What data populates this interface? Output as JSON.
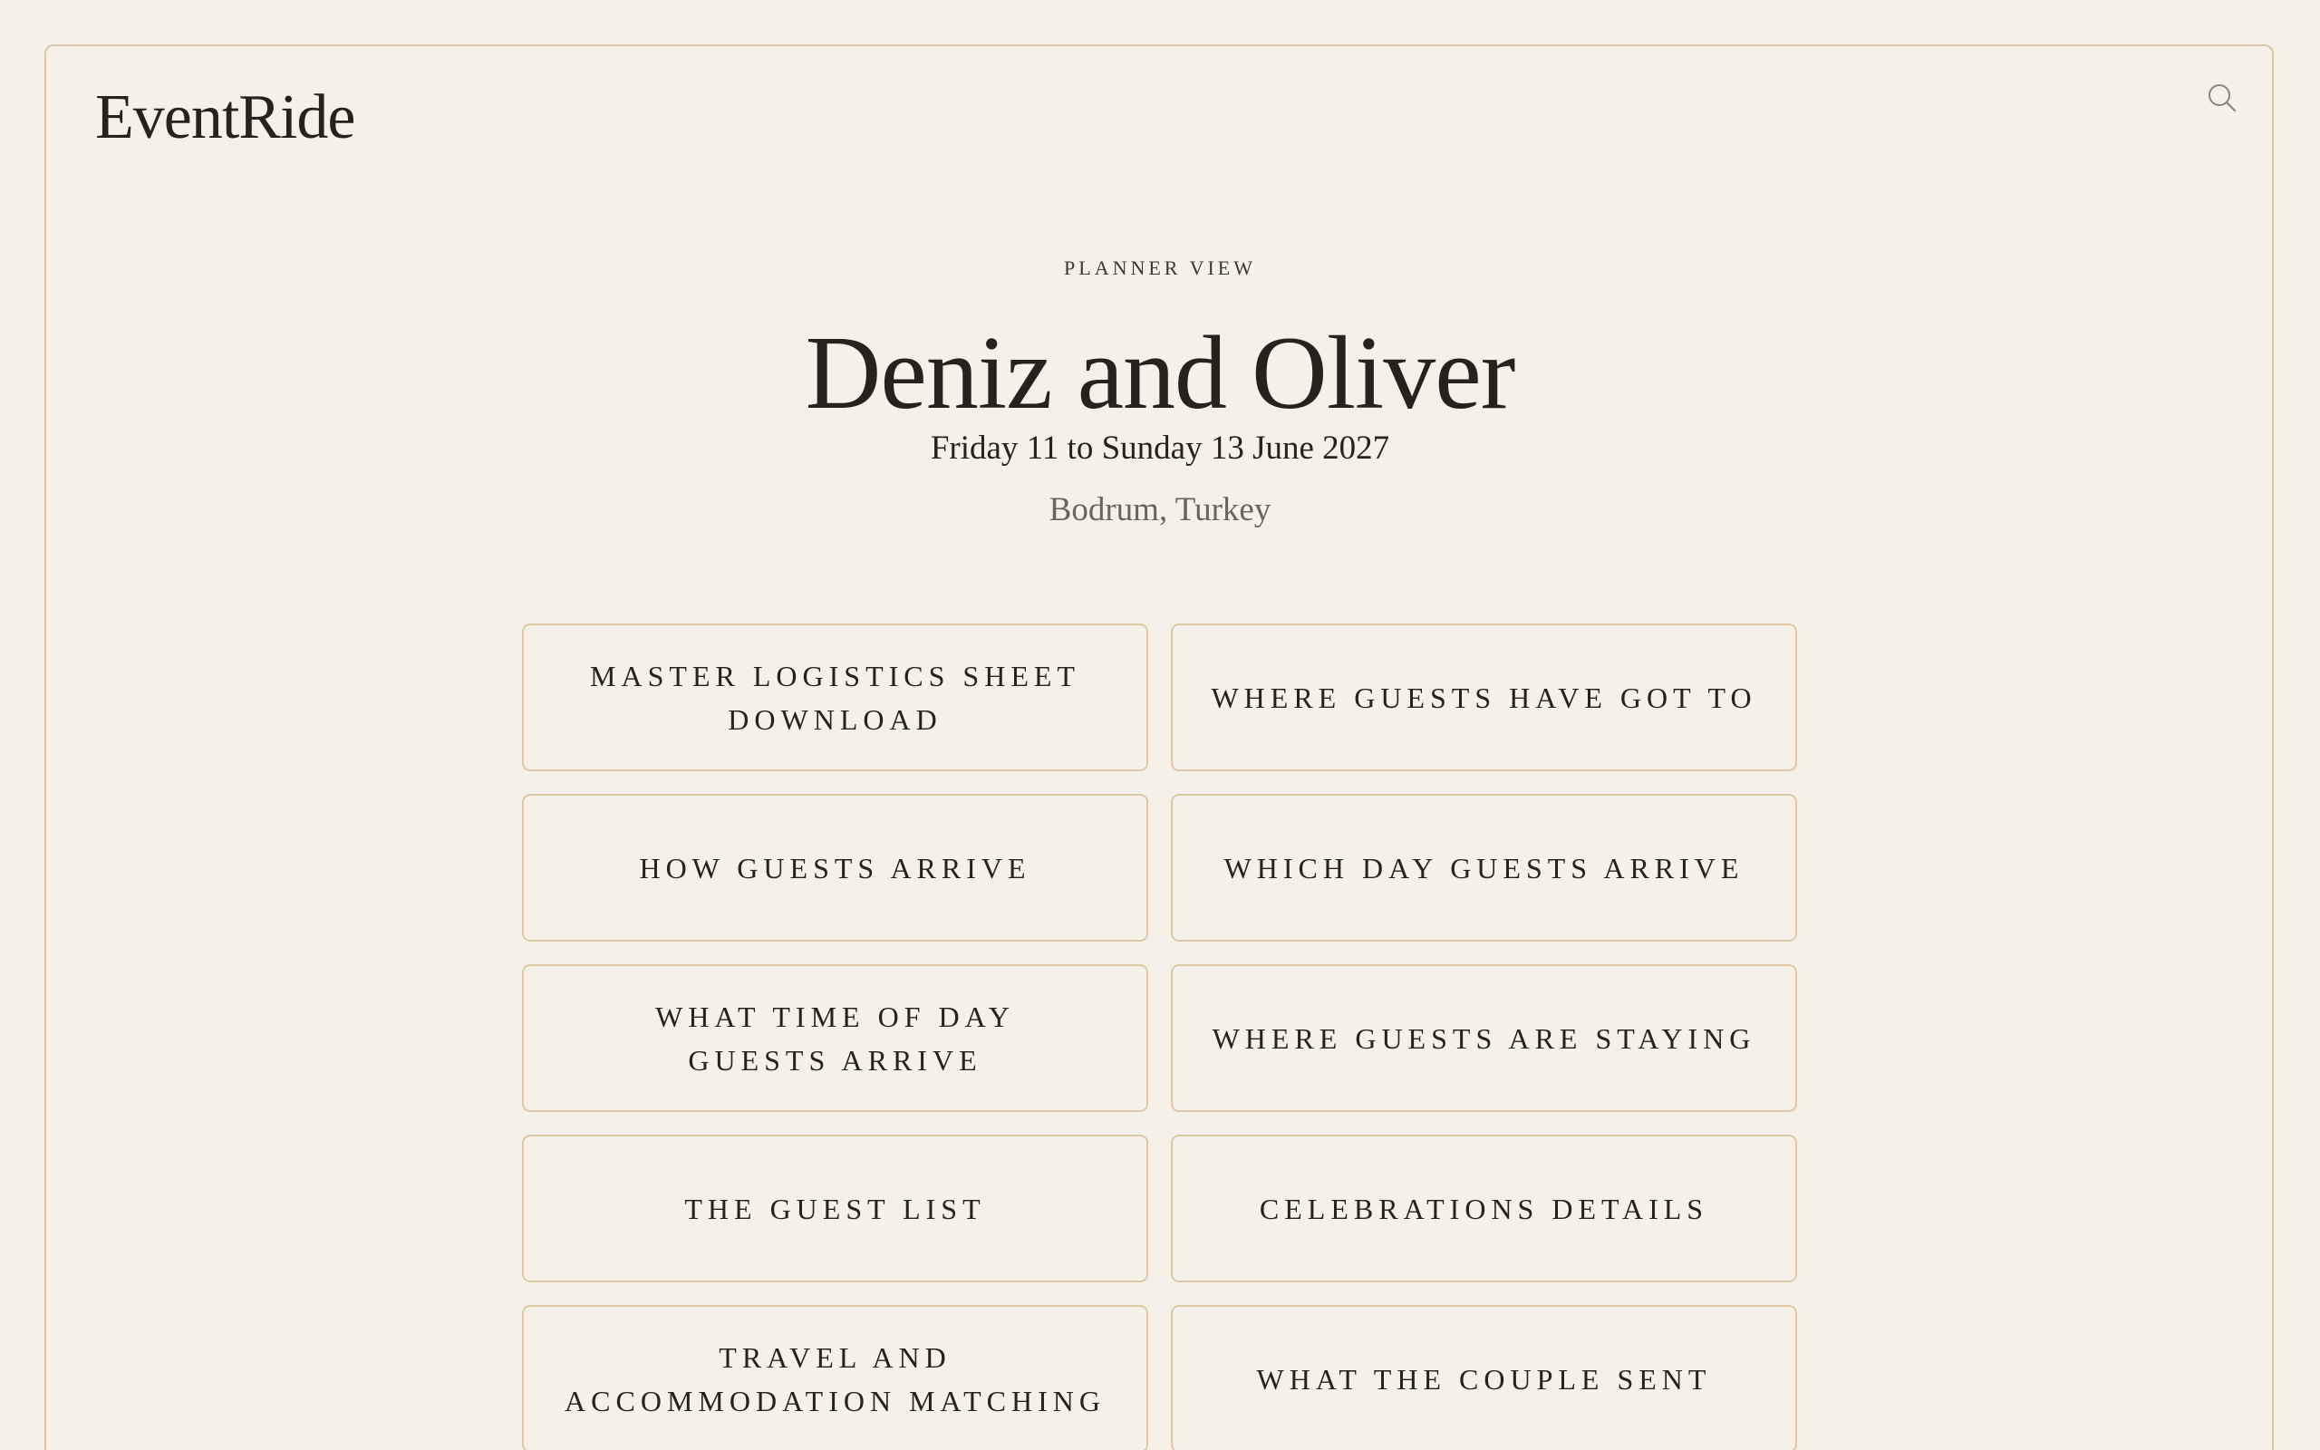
{
  "header": {
    "brand": "EventRide",
    "search_icon": "search-icon"
  },
  "event": {
    "eyebrow": "PLANNER VIEW",
    "title": "Deniz and Oliver",
    "dates": "Friday 11 to Sunday 13 June 2027",
    "location": "Bodrum, Turkey"
  },
  "tiles": [
    {
      "label": "MASTER LOGISTICS SHEET\nDOWNLOAD"
    },
    {
      "label": "WHERE GUESTS HAVE GOT TO"
    },
    {
      "label": "HOW GUESTS ARRIVE"
    },
    {
      "label": "WHICH DAY GUESTS ARRIVE"
    },
    {
      "label": "WHAT TIME OF DAY\nGUESTS ARRIVE"
    },
    {
      "label": "WHERE GUESTS ARE STAYING"
    },
    {
      "label": "THE GUEST LIST"
    },
    {
      "label": "CELEBRATIONS DETAILS"
    },
    {
      "label": "TRAVEL AND\nACCOMMODATION MATCHING"
    },
    {
      "label": "WHAT THE COUPLE SENT"
    }
  ],
  "colors": {
    "background": "#f5f1e8",
    "border": "#dcc9a6",
    "text": "#26231f",
    "muted": "#6a645b"
  }
}
